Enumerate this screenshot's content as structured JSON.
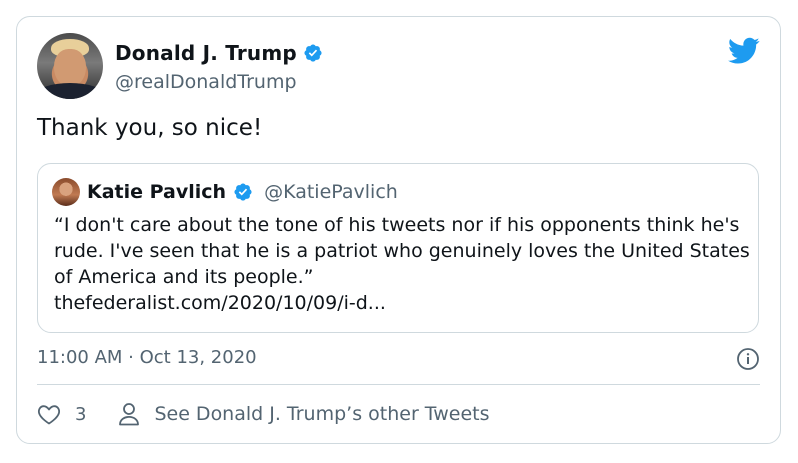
{
  "tweet": {
    "author": {
      "display_name": "Donald J. Trump",
      "handle": "@realDonaldTrump",
      "verified": true
    },
    "text": "Thank you, so nice!",
    "quoted": {
      "author_name": "Katie Pavlich",
      "author_handle": "@KatiePavlich",
      "verified": true,
      "body": "“I don't care about the tone of his tweets nor if his opponents think he's rude. I've seen that he is a patriot who genuinely loves the United States of America and its people.”",
      "link": "thefederalist.com/2020/10/09/i-d..."
    },
    "timestamp": "11:00 AM · Oct 13, 2020",
    "like_count": "3",
    "profile_link_label": "See Donald J. Trump’s other Tweets"
  },
  "icons": {
    "brand": "twitter-bird-icon",
    "verified": "verified-badge-icon",
    "info": "info-icon",
    "like": "heart-icon",
    "profile": "person-icon"
  },
  "colors": {
    "brand_blue": "#1d9bf0",
    "secondary_text": "#536471",
    "border": "#cfd9de"
  }
}
